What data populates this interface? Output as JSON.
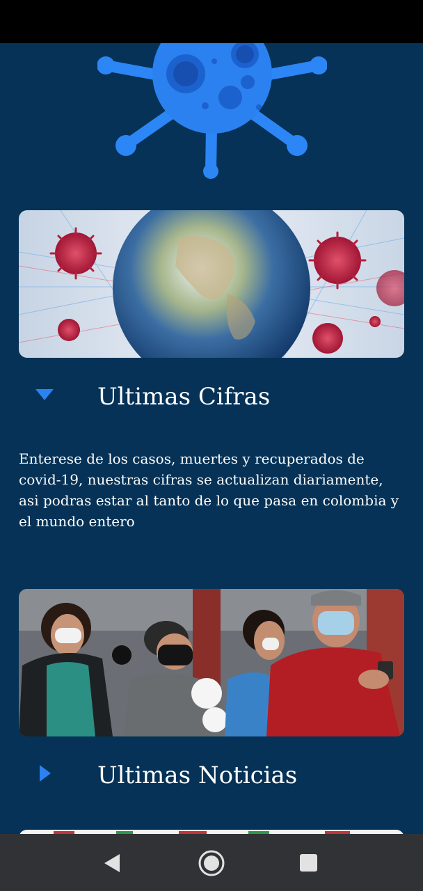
{
  "app": {
    "logo_icon": "virus-icon"
  },
  "colors": {
    "background": "#053256",
    "accent": "#2b82f0",
    "nav_bar": "#303236",
    "status_bar": "#000000"
  },
  "sections": [
    {
      "title": "Ultimas Cifras",
      "expanded": true,
      "toggle_icon": "triangle-down-icon",
      "description": "Enterese de los casos, muertes y recuperados de covid-19, nuestras cifras se actualizan diariamente, asi podras estar al tanto de lo que pasa en colombia y el mundo entero",
      "image_icon": "globe-virus-image"
    },
    {
      "title": "Ultimas Noticias",
      "expanded": false,
      "toggle_icon": "triangle-right-icon",
      "image_icon": "people-masks-image"
    }
  ],
  "navigation": {
    "back_icon": "back-icon",
    "home_icon": "home-icon",
    "recents_icon": "recents-icon"
  }
}
